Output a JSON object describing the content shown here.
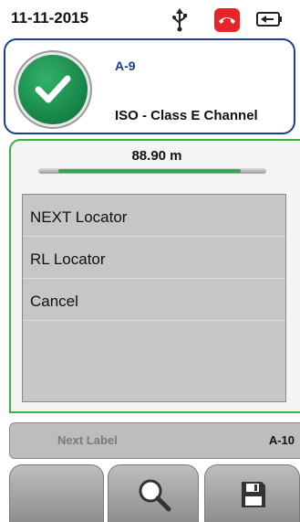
{
  "status": {
    "date": "11-11-2015",
    "icons": [
      "usb-icon",
      "phone-hangup-icon",
      "battery-icon"
    ],
    "phone_color": "#e8232a"
  },
  "result": {
    "status_icon": "check-pass-icon",
    "cable_id": "A-9",
    "standard": "ISO - Class E Channel",
    "accent_color": "#1c3f8f",
    "pass_color": "#18894a"
  },
  "length": {
    "value": "88.90 m",
    "fill_fraction": 0.8
  },
  "menu": {
    "items": [
      {
        "label": "NEXT Locator"
      },
      {
        "label": "RL Locator"
      },
      {
        "label": "Cancel"
      }
    ]
  },
  "next": {
    "label": "Next Label",
    "id": "A-10"
  },
  "softkeys": [
    {
      "icon": ""
    },
    {
      "icon": "magnifier-icon"
    },
    {
      "icon": "save-icon"
    }
  ]
}
